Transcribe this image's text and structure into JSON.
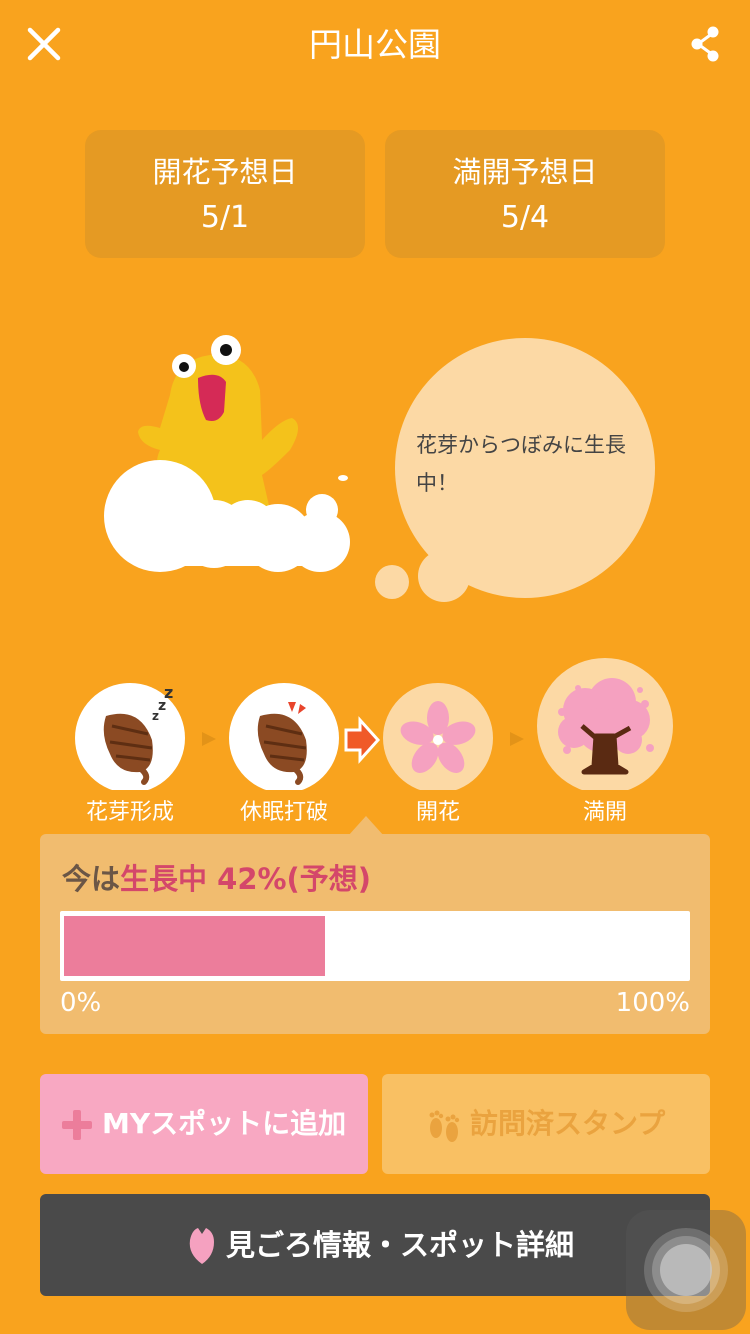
{
  "header": {
    "title": "円山公園",
    "close_icon": "close-icon",
    "share_icon": "share-icon"
  },
  "forecast": {
    "bloom_label": "開花予想日",
    "bloom_value": "5/1",
    "full_label": "満開予想日",
    "full_value": "5/4"
  },
  "speech": {
    "line1": "花芽からつぼみに生長",
    "line2": "中！"
  },
  "stages": [
    {
      "label": "花芽形成",
      "icon": "bud-sleeping-icon"
    },
    {
      "label": "休眠打破",
      "icon": "bud-awakening-icon"
    },
    {
      "label": "開花",
      "icon": "sakura-flower-icon"
    },
    {
      "label": "満開",
      "icon": "full-bloom-tree-icon"
    }
  ],
  "progress": {
    "prefix": "今は",
    "stage": "生長中",
    "percent_text": "42%(予想)",
    "value": 0.42,
    "min_label": "0%",
    "max_label": "100%"
  },
  "buttons": {
    "my_spot": "MYスポットに追加",
    "stamp": "訪問済スタンプ",
    "detail": "見ごろ情報・スポット詳細"
  },
  "colors": {
    "background": "#F9A31E",
    "card": "#E59A23",
    "panel": "#F1BC6F",
    "progress_fill": "#EC7D9B",
    "accent_pink": "#D4476A",
    "my_spot_button": "#F8A8C2",
    "stamp_button": "#F9C063",
    "detail_button": "#4A4A4A"
  }
}
